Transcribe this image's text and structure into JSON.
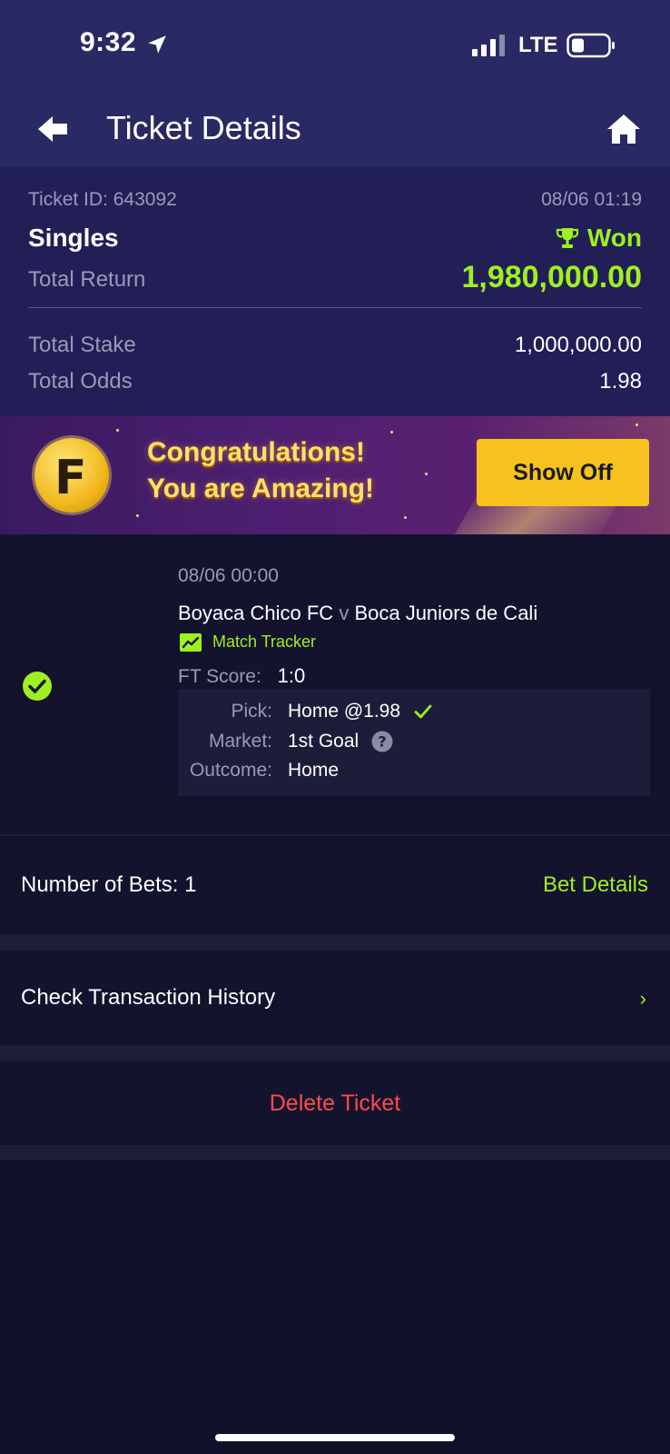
{
  "status_bar": {
    "time": "9:32",
    "network": "LTE"
  },
  "nav": {
    "title": "Ticket Details"
  },
  "summary": {
    "ticket_id": "Ticket ID: 643092",
    "date": "08/06 01:19",
    "type": "Singles",
    "status": "Won",
    "total_return_label": "Total Return",
    "total_return_value": "1,980,000.00",
    "total_stake_label": "Total Stake",
    "total_stake_value": "1,000,000.00",
    "total_odds_label": "Total Odds",
    "total_odds_value": "1.98"
  },
  "banner": {
    "line1": "Congratulations!",
    "line2": "You are Amazing!",
    "button": "Show Off"
  },
  "bet": {
    "date": "08/06 00:00",
    "home_team": "Boyaca Chico FC",
    "vs": "v",
    "away_team": "Boca Juniors de Cali",
    "tracker": "Match Tracker",
    "ft_label": "FT Score:",
    "ft_value": "1:0",
    "pick_label": "Pick:",
    "pick_value": "Home @1.98",
    "market_label": "Market:",
    "market_value": "1st Goal",
    "outcome_label": "Outcome:",
    "outcome_value": "Home"
  },
  "footer": {
    "num_bets": "Number of Bets: 1",
    "bet_details": "Bet Details",
    "history": "Check Transaction History",
    "delete": "Delete Ticket"
  },
  "colors": {
    "accent": "#9ef020",
    "header": "#292964",
    "summary": "#211f56",
    "danger": "#ff4a4a",
    "button": "#f7c21e"
  }
}
